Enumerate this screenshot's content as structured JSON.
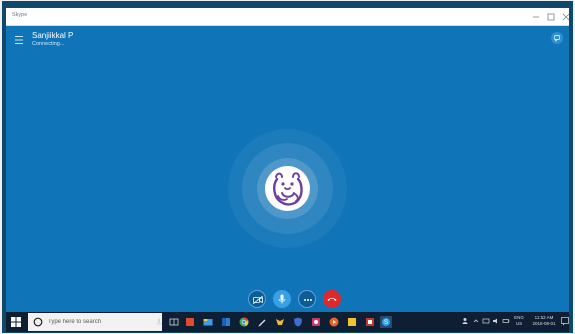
{
  "window": {
    "title": "Skype",
    "buttons": [
      "minimize-icon",
      "maximize-icon",
      "close-icon"
    ]
  },
  "call": {
    "contact_name": "Sanjiikkal P",
    "status": "Connecting...",
    "avatar_icon": "ferret-cartoon-avatar",
    "controls": [
      "video-icon",
      "microphone-icon",
      "more-icon",
      "end-call-icon"
    ]
  },
  "taskbar": {
    "search_placeholder": "Type here to search",
    "apps": [
      "task-view-icon",
      "store-icon",
      "chrome-icon",
      "explorer-icon",
      "mail-icon",
      "photos-icon",
      "paint-icon",
      "app-icon",
      "shield-icon",
      "skype-icon"
    ],
    "lang_line1": "ENG",
    "lang_line2": "US",
    "time": "11:52 AM",
    "date": "2018-08-01"
  },
  "colors": {
    "call_background": "#0f74b8",
    "end_call": "#e0282b",
    "mic_active": "#3aa0e6",
    "taskbar": "#0e1f33",
    "avatar_accent": "#6d3e9f"
  }
}
